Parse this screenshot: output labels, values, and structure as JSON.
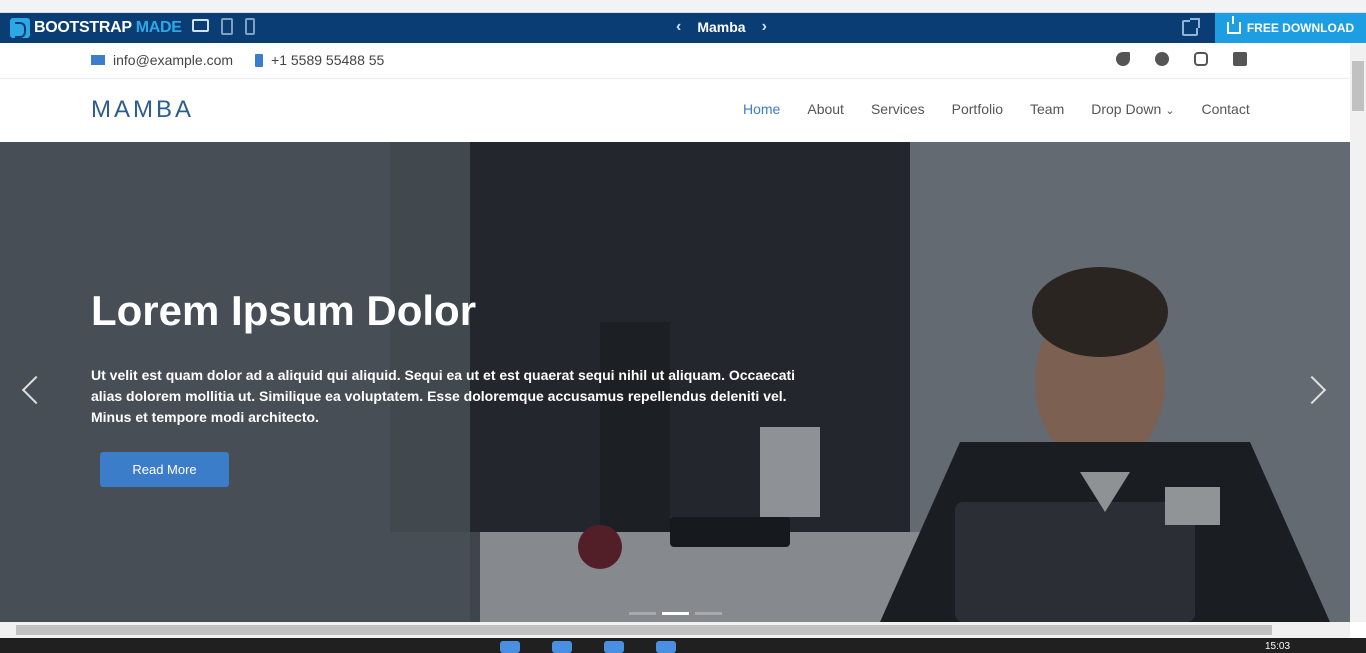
{
  "bootstrapmade": {
    "logo_bootstrap": "BOOTSTRAP",
    "logo_made": "MADE",
    "theme_name": "Mamba",
    "download_label": "FREE DOWNLOAD"
  },
  "topbar": {
    "email": "info@example.com",
    "phone": "+1 5589 55488 55"
  },
  "header": {
    "logo": "MAMBA",
    "nav": [
      "Home",
      "About",
      "Services",
      "Portfolio",
      "Team",
      "Drop Down",
      "Contact"
    ]
  },
  "hero": {
    "title": "Lorem Ipsum Dolor",
    "description": "Ut velit est quam dolor ad a aliquid qui aliquid. Sequi ea ut et est quaerat sequi nihil ut aliquam. Occaecati alias dolorem mollitia ut. Similique ea voluptatem. Esse doloremque accusamus repellendus deleniti vel. Minus et tempore modi architecto.",
    "button": "Read More",
    "slide_indicator_active": 2,
    "slide_count": 3
  },
  "taskbar": {
    "time": "15:03"
  },
  "colors": {
    "bm_bar": "#0a3d73",
    "download": "#1d9de2",
    "accent": "#3b7dc9"
  }
}
